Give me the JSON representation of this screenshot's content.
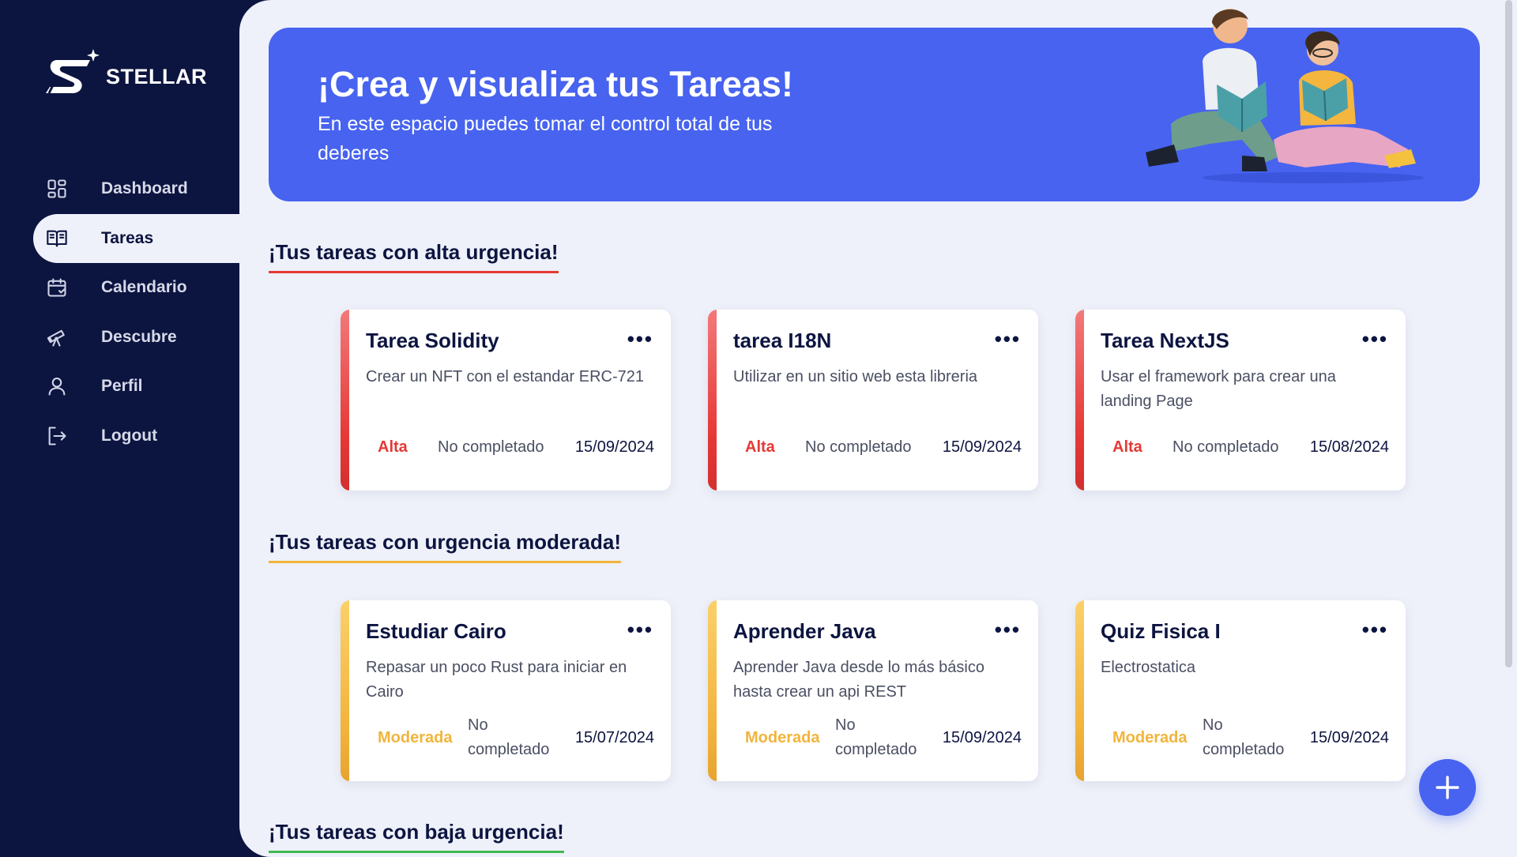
{
  "app": {
    "name": "STELLAR"
  },
  "sidebar": {
    "items": [
      {
        "label": "Dashboard",
        "icon": "dashboard-icon"
      },
      {
        "label": "Tareas",
        "icon": "book-open-icon",
        "active": true
      },
      {
        "label": "Calendario",
        "icon": "calendar-icon"
      },
      {
        "label": "Descubre",
        "icon": "telescope-icon"
      },
      {
        "label": "Perfil",
        "icon": "user-icon"
      },
      {
        "label": "Logout",
        "icon": "logout-icon"
      }
    ]
  },
  "hero": {
    "title": "¡Crea y visualiza tus Tareas!",
    "subtitle": "En este espacio puedes tomar el control total de tus deberes"
  },
  "sections": {
    "high": {
      "title": "¡Tus tareas con alta urgencia!",
      "tasks": [
        {
          "title": "Tarea Solidity",
          "description": "Crear un NFT con el estandar ERC-721",
          "priority": "Alta",
          "status": "No completado",
          "date": "15/09/2024"
        },
        {
          "title": "tarea I18N",
          "description": "Utilizar en un sitio web esta libreria",
          "priority": "Alta",
          "status": "No completado",
          "date": "15/09/2024"
        },
        {
          "title": "Tarea NextJS",
          "description": "Usar el framework para crear una landing Page",
          "priority": "Alta",
          "status": "No completado",
          "date": "15/08/2024"
        }
      ]
    },
    "moderate": {
      "title": "¡Tus tareas con urgencia moderada!",
      "tasks": [
        {
          "title": "Estudiar Cairo",
          "description": "Repasar un poco Rust para iniciar en Cairo",
          "priority": "Moderada",
          "status": "No completado",
          "date": "15/07/2024"
        },
        {
          "title": "Aprender Java",
          "description": "Aprender Java desde lo más básico hasta crear un api REST",
          "priority": "Moderada",
          "status": "No completado",
          "date": "15/09/2024"
        },
        {
          "title": "Quiz Fisica I",
          "description": "Electrostatica",
          "priority": "Moderada",
          "status": "No completado",
          "date": "15/09/2024"
        }
      ]
    },
    "low": {
      "title": "¡Tus tareas con baja urgencia!"
    }
  },
  "card_menu_label": "•••",
  "colors": {
    "sidebar": "#0c1440",
    "accent": "#4763ef",
    "background": "#eef1f9",
    "high": "#e53935",
    "moderate": "#f2b43c",
    "low": "#3fb950"
  }
}
